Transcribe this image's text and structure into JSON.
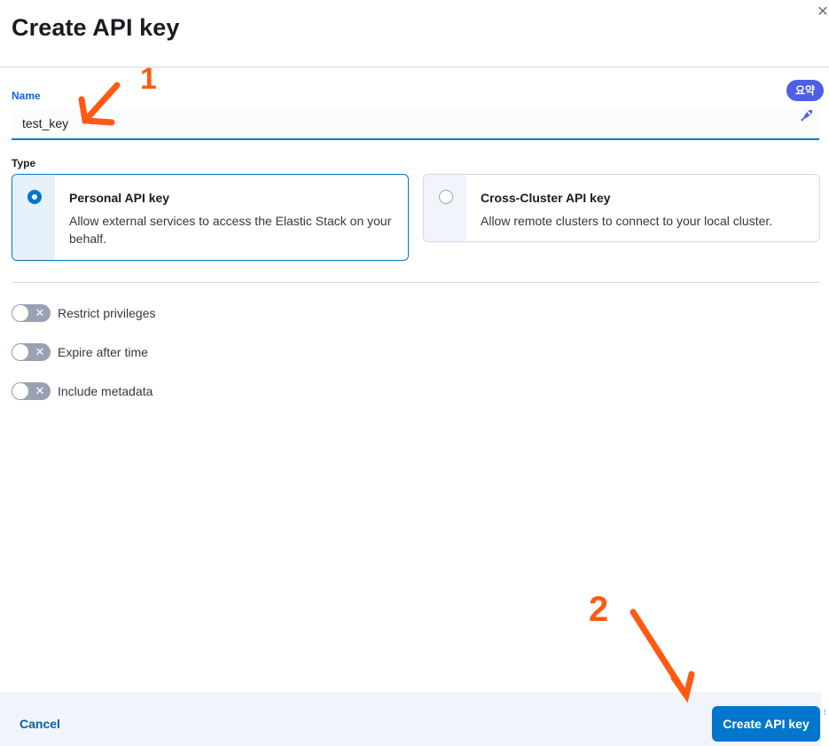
{
  "dialog": {
    "title": "Create API key",
    "close_icon": "close-icon"
  },
  "form": {
    "name_label": "Name",
    "name_value": "test_key",
    "type_label": "Type",
    "types": [
      {
        "title": "Personal API key",
        "description": "Allow external services to access the Elastic Stack on your behalf.",
        "selected": true
      },
      {
        "title": "Cross-Cluster API key",
        "description": "Allow remote clusters to connect to your local cluster.",
        "selected": false
      }
    ],
    "toggles": [
      {
        "label": "Restrict privileges",
        "on": false
      },
      {
        "label": "Expire after time",
        "on": false
      },
      {
        "label": "Include metadata",
        "on": false
      }
    ]
  },
  "footer": {
    "cancel_label": "Cancel",
    "create_label": "Create API key"
  },
  "extension_widget": {
    "badge_label": "요약"
  },
  "annotations": {
    "step_1": "1",
    "step_2": "2",
    "color": "#ff5a14"
  },
  "colors": {
    "primary": "#0077cc",
    "footer_bg": "#f1f4fa",
    "badge": "#4d5fe6"
  }
}
